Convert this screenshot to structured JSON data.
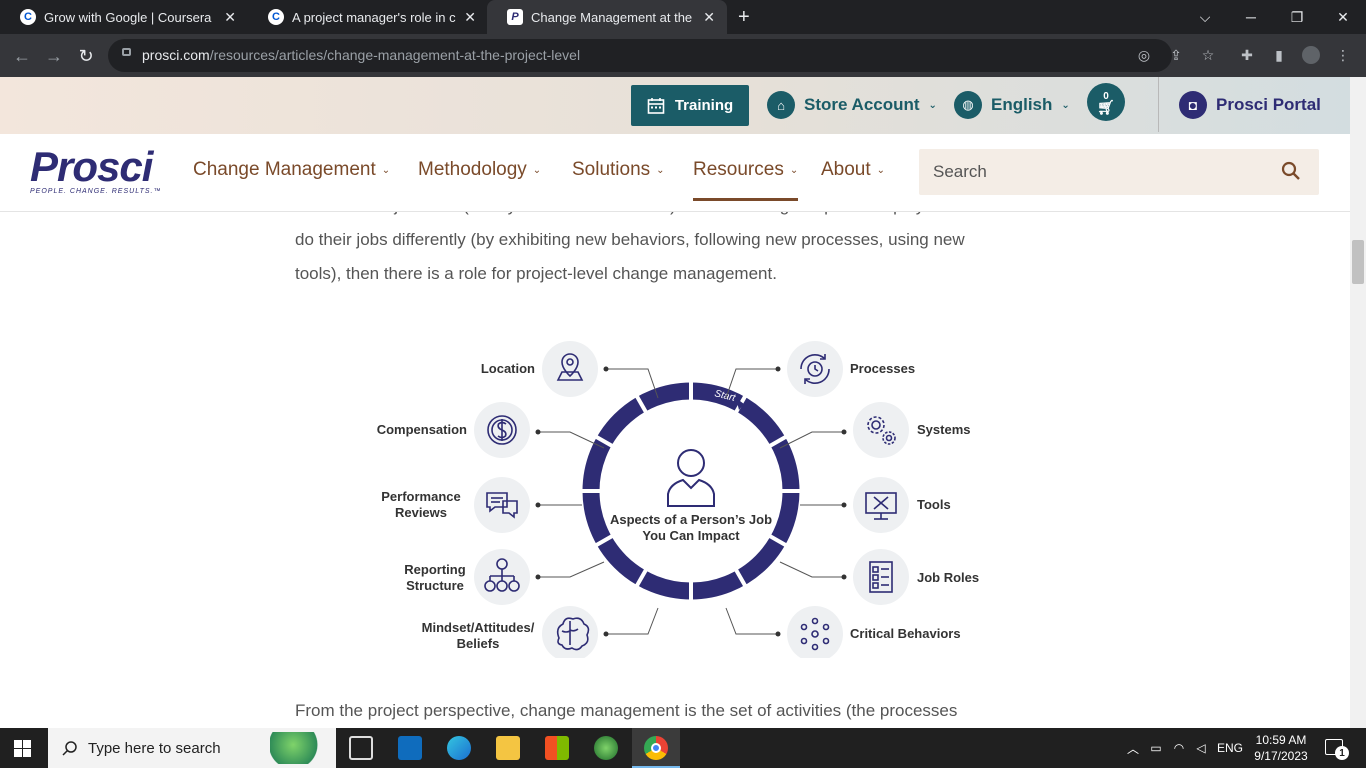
{
  "browser": {
    "tabs": [
      {
        "title": "Grow with Google | Coursera",
        "favicon": "C"
      },
      {
        "title": "A project manager's role in chang",
        "favicon": "C"
      },
      {
        "title": "Change Management at the Proje",
        "favicon": "P"
      }
    ],
    "url_domain": "prosci.com",
    "url_path": "/resources/articles/change-management-at-the-project-level"
  },
  "utility": {
    "training": "Training",
    "store_account": "Store Account",
    "language": "English",
    "cart_count": "0",
    "portal": "Prosci Portal"
  },
  "nav": {
    "logo": "Prosci",
    "tagline": "PEOPLE. CHANGE. RESULTS.™",
    "items": [
      {
        "label": "Change Management"
      },
      {
        "label": "Methodology"
      },
      {
        "label": "Solutions"
      },
      {
        "label": "Resources"
      },
      {
        "label": "About"
      }
    ],
    "search_placeholder": "Search"
  },
  "article": {
    "para_top": [
      "structures or job roles (or any combination thereof). But if a change requires employees to",
      "do their jobs differently (by exhibiting new behaviors, following new processes, using new",
      "tools), then there is a role for project-level change management."
    ],
    "para_bottom": "From the project perspective, change management is the set of activities (the processes"
  },
  "diagram": {
    "center_title_1": "Aspects of a Person’s Job",
    "center_title_2": "You Can Impact",
    "start_label": "Start",
    "left_items": [
      {
        "label": "Location",
        "icon": "location-pin-icon"
      },
      {
        "label": "Compensation",
        "icon": "dollar-icon"
      },
      {
        "label": "Performance",
        "label2": "Reviews",
        "icon": "chat-bubbles-icon"
      },
      {
        "label": "Reporting",
        "label2": "Structure",
        "icon": "org-chart-icon"
      },
      {
        "label": "Mindset/Attitudes/",
        "label2": "Beliefs",
        "icon": "brain-icon"
      }
    ],
    "right_items": [
      {
        "label": "Processes",
        "icon": "cycle-clock-icon"
      },
      {
        "label": "Systems",
        "icon": "gears-icon"
      },
      {
        "label": "Tools",
        "icon": "tools-monitor-icon"
      },
      {
        "label": "Job Roles",
        "icon": "checklist-icon"
      },
      {
        "label": "Critical Behaviors",
        "icon": "dots-cluster-icon"
      }
    ],
    "colors": {
      "ring": "#2e2c74",
      "icon_bg": "#eef0f2",
      "connector": "#555555"
    }
  },
  "taskbar": {
    "search_placeholder": "Type here to search",
    "lang": "ENG",
    "time": "10:59 AM",
    "date": "9/17/2023",
    "notification_count": "1"
  }
}
